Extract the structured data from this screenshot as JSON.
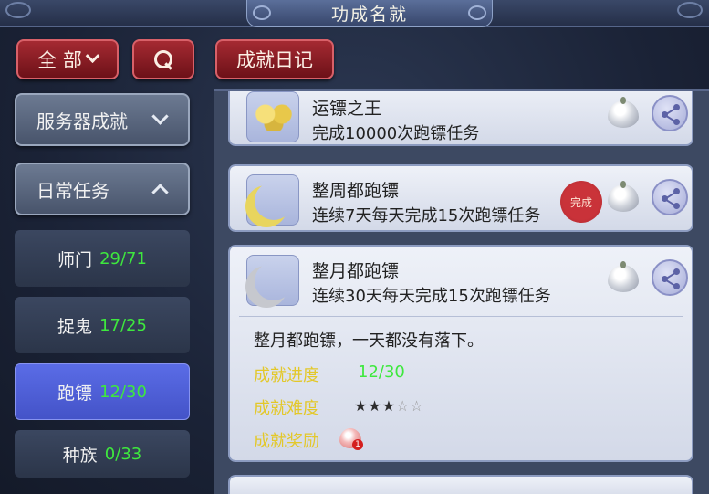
{
  "window": {
    "title": "功成名就"
  },
  "toolbar": {
    "all_label": "全 部",
    "diary_label": "成就日记"
  },
  "sidebar": {
    "categories": [
      {
        "label": "服务器成就"
      },
      {
        "label": "日常任务"
      }
    ],
    "subitems": [
      {
        "label": "师门",
        "count": "29/71"
      },
      {
        "label": "捉鬼",
        "count": "17/25"
      },
      {
        "label": "跑镖",
        "count": "12/30"
      },
      {
        "label": "种族",
        "count": "0/33"
      }
    ]
  },
  "achievements": [
    {
      "title": "运镖之王",
      "desc": "完成10000次跑镖任务"
    },
    {
      "title": "整周都跑镖",
      "desc": "连续7天每天完成15次跑镖任务",
      "seal_text": "完成"
    },
    {
      "title": "整月都跑镖",
      "desc": "连续30天每天完成15次跑镖任务"
    }
  ],
  "detail": {
    "description": "整月都跑镖，一天都没有落下。",
    "progress_label": "成就进度",
    "progress_value": "12/30",
    "difficulty_label": "成就难度",
    "difficulty_stars": {
      "filled": 3,
      "total": 5
    },
    "stars_filled": "★★★",
    "stars_empty": "☆☆",
    "reward_label": "成就奖励",
    "reward_badge": "1"
  },
  "colors": {
    "accent_green": "#3ee83e",
    "label_gold": "#e3c82a",
    "button_red": "#a52a32",
    "active_blue": "#4f60d8"
  }
}
